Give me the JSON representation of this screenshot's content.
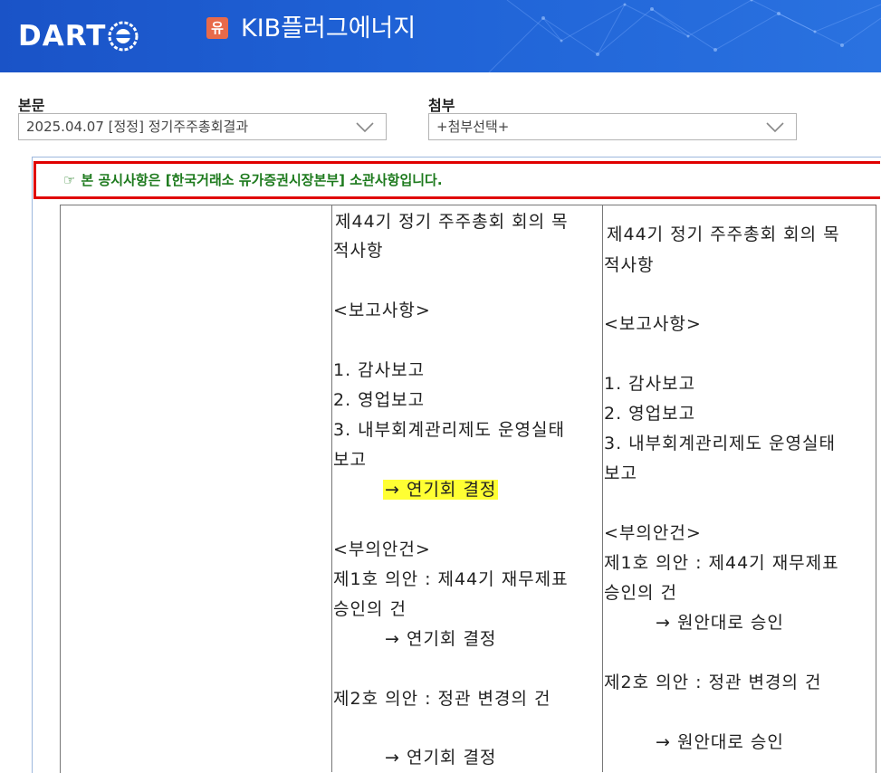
{
  "header": {
    "logo_text": "DART",
    "corp_badge": "유",
    "corp_name": "KIB플러그에너지"
  },
  "main_doc": {
    "label": "본문",
    "selected": "2025.04.07  [정정] 정기주주총회결과"
  },
  "attachment": {
    "label": "첨부",
    "selected": "+첨부선택+"
  },
  "notice": {
    "icon": "pointing-hand-icon",
    "hand": "☞",
    "text": "본 공시사항은 [한국거래소 유가증권시장본부] 소관사항입니다."
  },
  "table": {
    "column_before": [
      "제44기 정기 주주총회 회의 목",
      "적사항",
      "",
      "<보고사항>",
      "",
      "1. 감사보고",
      "2. 영업보고",
      "3. 내부회계관리제도 운영실태",
      "보고",
      "→ 연기회 결정",
      "",
      "<부의안건>",
      "제1호 의안 : 제44기 재무제표",
      "승인의 건",
      "→ 연기회 결정",
      "",
      "제2호 의안 : 정관 변경의 건",
      "",
      "→ 연기회 결정"
    ],
    "column_after": [
      "제44기 정기 주주총회 회의 목",
      "적사항",
      "",
      "<보고사항>",
      "",
      "1. 감사보고",
      "2. 영업보고",
      "3. 내부회계관리제도 운영실태",
      "보고",
      "",
      "<부의안건>",
      "제1호 의안 : 제44기 재무제표",
      "승인의 건",
      "→ 원안대로 승인",
      "",
      "제2호 의안 : 정관 변경의 건",
      "",
      "→ 원안대로 승인"
    ],
    "highlighted_text": "→ 연기회 결정",
    "highlight_color": "#ffff33"
  },
  "colors": {
    "header_blue": "#1f62d6",
    "notice_border": "#e00000",
    "notice_text": "#1d7a1d"
  }
}
